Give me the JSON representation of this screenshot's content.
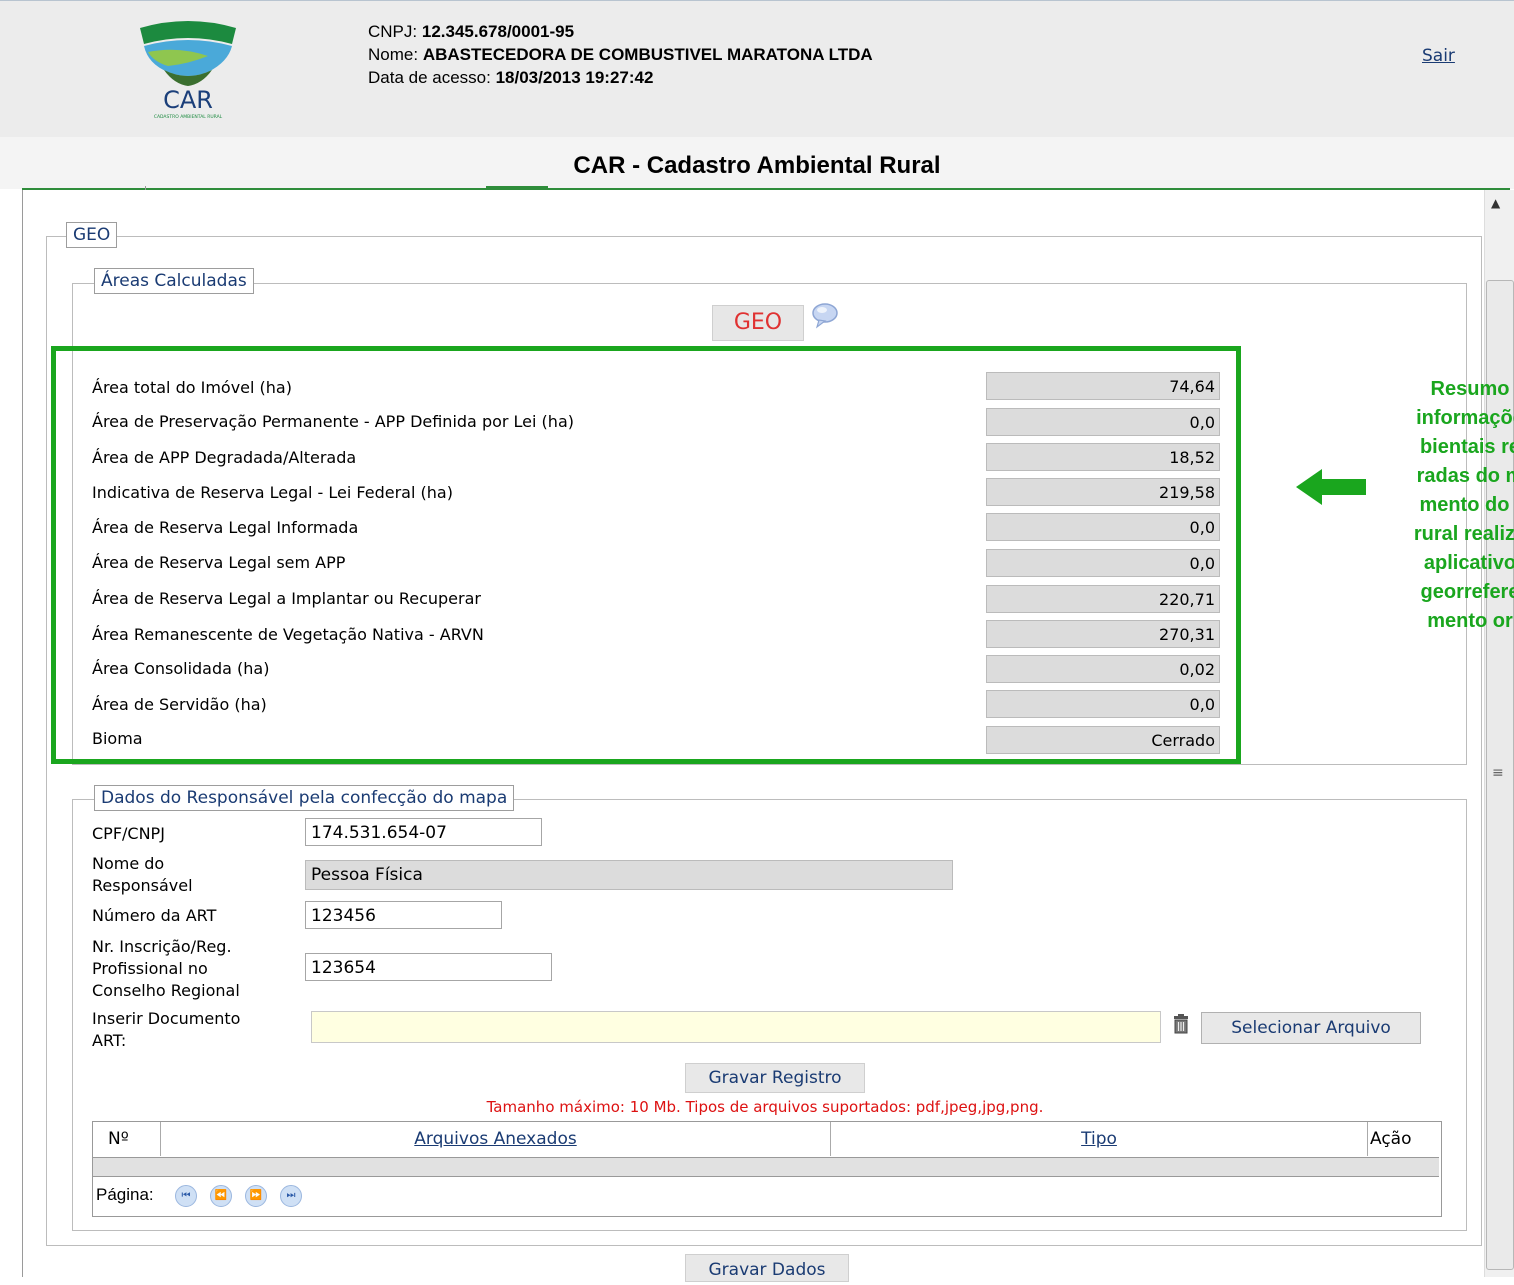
{
  "header": {
    "logo_text": "CAR",
    "logo_subtext": "CADASTRO AMBIENTAL RURAL",
    "cnpj_label": "CNPJ:",
    "cnpj_value": "12.345.678/0001-95",
    "nome_label": "Nome:",
    "nome_value": "ABASTECEDORA DE COMBUSTIVEL MARATONA LTDA",
    "data_label": "Data de acesso:",
    "data_value": "18/03/2013 19:27:42",
    "logout_label": "Sair"
  },
  "app_title": "CAR - Cadastro Ambiental Rural",
  "geo_section": {
    "legend": "GEO",
    "areas_legend": "Áreas Calculadas",
    "geo_button": "GEO",
    "areas": [
      {
        "label": "Área total do Imóvel (ha)",
        "value": "74,64"
      },
      {
        "label": "Área de Preservação Permanente - APP Definida por Lei (ha)",
        "value": "0,0"
      },
      {
        "label": "Área de APP Degradada/Alterada",
        "value": "18,52"
      },
      {
        "label": "Indicativa de Reserva Legal - Lei Federal (ha)",
        "value": "219,58"
      },
      {
        "label": "Área de Reserva Legal Informada",
        "value": "0,0"
      },
      {
        "label": "Área de Reserva Legal sem APP",
        "value": "0,0"
      },
      {
        "label": "Área de Reserva Legal a Implantar ou Recuperar",
        "value": "220,71"
      },
      {
        "label": "Área Remanescente de Vegetação Nativa - ARVN",
        "value": "270,31"
      },
      {
        "label": "Área Consolidada (ha)",
        "value": "0,02"
      },
      {
        "label": "Área de Servidão (ha)",
        "value": "0,0"
      },
      {
        "label": "Bioma",
        "value": "Cerrado"
      }
    ]
  },
  "callout": {
    "lines": [
      "Resumo",
      "informaçõe",
      "bientais re",
      "radas do m",
      "mento do i",
      "rural realiza",
      "aplicativo",
      "georrefere",
      "mento or"
    ],
    "color": "#1aa61e"
  },
  "responsavel": {
    "legend": "Dados do Responsável pela confecção do mapa",
    "cpf_label": "CPF/CNPJ",
    "cpf_value": "174.531.654-07",
    "nome_label_1": "Nome do",
    "nome_label_2": "Responsável",
    "nome_value": "Pessoa Física",
    "art_label": "Número da ART",
    "art_value": "123456",
    "insc_label_1": "Nr. Inscrição/Reg.",
    "insc_label_2": "Profissional no",
    "insc_label_3": "Conselho Regional",
    "insc_value": "123654",
    "doc_label_1": "Inserir Documento",
    "doc_label_2": "ART:",
    "doc_value": "",
    "select_file_button": "Selecionar Arquivo",
    "save_record_button": "Gravar Registro",
    "max_size_note": "Tamanho máximo: 10 Mb. Tipos de arquivos suportados: pdf,jpeg,jpg,png."
  },
  "files_table": {
    "columns": [
      "Nº",
      "Arquivos Anexados",
      "Tipo",
      "Ação"
    ],
    "rows": [],
    "pager_label": "Página:"
  },
  "save_data_button": "Gravar Dados",
  "colors": {
    "highlight": "#1aa61e",
    "link": "#1a3b73",
    "warning": "#dd1111"
  }
}
